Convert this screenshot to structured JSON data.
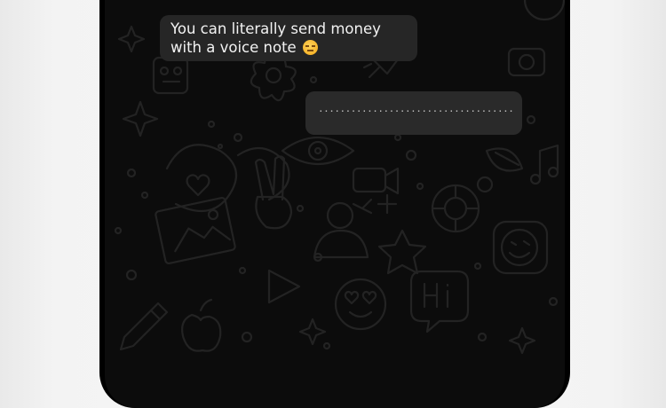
{
  "chat": {
    "incoming_message": {
      "text": "You can literally send money with a voice note",
      "emoji": "unamused-face-emoji"
    },
    "outgoing_message": {
      "text": "...................................................."
    }
  },
  "colors": {
    "screen_background": "#0c0c0c",
    "doodle_stroke": "#232323",
    "incoming_bubble": "#262626",
    "outgoing_bubble": "#2a2a2a"
  }
}
